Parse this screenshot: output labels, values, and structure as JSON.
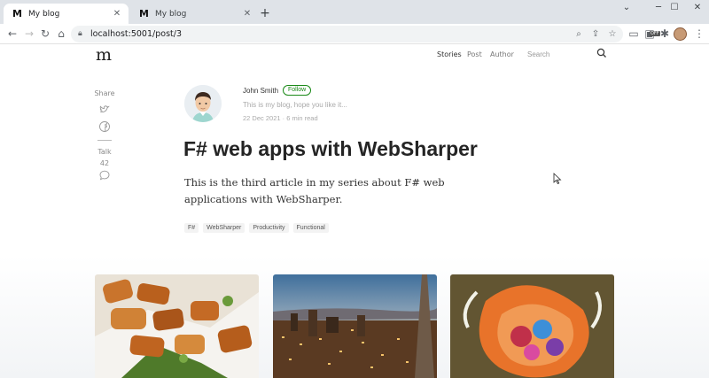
{
  "browser": {
    "tabs": [
      {
        "favicon": "M",
        "title": "My blog"
      },
      {
        "favicon": "M",
        "title": "My blog"
      }
    ],
    "new_tab_icon": "plus-icon",
    "url": "localhost:5001/post/3",
    "extension_badge": "OFF"
  },
  "site": {
    "brand": "m",
    "nav": [
      "Stories",
      "Post",
      "Author"
    ],
    "search_placeholder": "Search"
  },
  "share": {
    "label": "Share",
    "talk_label": "Talk",
    "talk_count": "42"
  },
  "author": {
    "name": "John Smith",
    "follow_label": "Follow",
    "bio": "This is my blog, hope you like it...",
    "meta": "22 Dec 2021 · 6 min read"
  },
  "post": {
    "title": "F# web apps with WebSharper",
    "lead": "This is the third article in my series about F# web applications with WebSharper.",
    "tags": [
      "F#",
      "WebSharper",
      "Productivity",
      "Functional"
    ]
  },
  "colors": {
    "accent_green": "#1a8917",
    "title_text": "#242424",
    "chrome_tabbar": "#dfe3e8"
  }
}
